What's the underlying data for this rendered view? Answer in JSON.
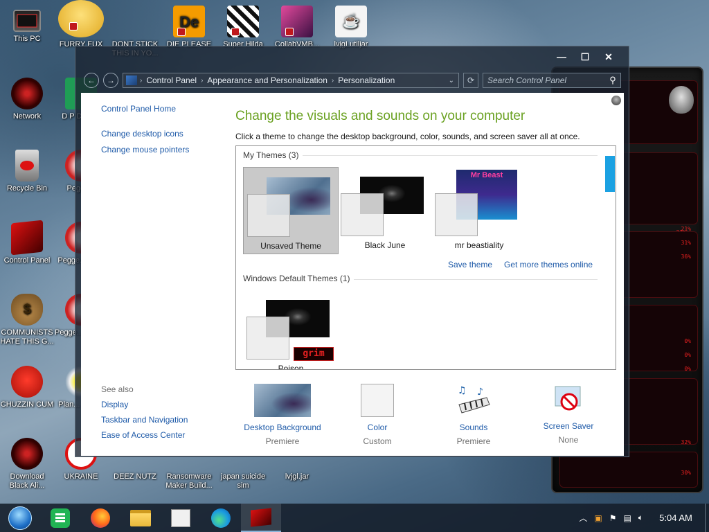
{
  "desktop": {
    "icons": [
      {
        "label": "This PC"
      },
      {
        "label": "FURRY FUX"
      },
      {
        "label": "DONT STICK THIS IN YO..."
      },
      {
        "label": "DIE PLEASE"
      },
      {
        "label": "Super Hilda"
      },
      {
        "label": "CollabVMB..."
      },
      {
        "label": "lvjgLutiljar"
      },
      {
        "label": "Network"
      },
      {
        "label": "D P DUM..."
      },
      {
        "label": "Recycle Bin"
      },
      {
        "label": "Pegge..."
      },
      {
        "label": "Control Panel"
      },
      {
        "label": "Pegge... De..."
      },
      {
        "label": "COMMUNISTS HATE THIS G..."
      },
      {
        "label": "Pegge... of War"
      },
      {
        "label": "CHUZZIN CUM"
      },
      {
        "label": "Plan... Zom..."
      },
      {
        "label": "Download Black Ali..."
      },
      {
        "label": "UKRAINE"
      },
      {
        "label": "DEEZ NUTZ"
      },
      {
        "label": "Ransomware Maker Build..."
      },
      {
        "label": "japan suicide sim"
      },
      {
        "label": "lvjgl.jar"
      }
    ],
    "glyph_de": "De"
  },
  "window": {
    "controls": {
      "minimize": "—",
      "maximize": "☐",
      "close": "✕"
    },
    "nav": {
      "back": "←",
      "forward": "→"
    },
    "breadcrumb": [
      "Control Panel",
      "Appearance and Personalization",
      "Personalization"
    ],
    "breadcrumb_sep": "›",
    "dropdown": "⌄",
    "refresh": "⟳",
    "search_placeholder": "Search Control Panel",
    "search_icon": "⚲"
  },
  "left_pane": {
    "links": [
      "Control Panel Home",
      "Change desktop icons",
      "Change mouse pointers"
    ]
  },
  "see_also": {
    "header": "See also",
    "links": [
      "Display",
      "Taskbar and Navigation",
      "Ease of Access Center"
    ]
  },
  "main": {
    "title": "Change the visuals and sounds on your computer",
    "subtitle": "Click a theme to change the desktop background, color, sounds, and screen saver all at once.",
    "my_themes_header": "My Themes (3)",
    "my_themes": [
      {
        "name": "Unsaved Theme",
        "selected": true
      },
      {
        "name": "Black June",
        "selected": false
      },
      {
        "name": "mr beastiality",
        "selected": false
      }
    ],
    "save_theme": "Save theme",
    "get_more": "Get more themes online",
    "default_header": "Windows Default Themes (1)",
    "default_themes": [
      {
        "name": "Poison"
      }
    ],
    "mrbeast_text": "Mr Beast",
    "grim_text": "grim"
  },
  "bottom_options": [
    {
      "label": "Desktop Background",
      "value": "Premiere",
      "icon": "desktop-background-icon"
    },
    {
      "label": "Color",
      "value": "Custom",
      "icon": "color-icon"
    },
    {
      "label": "Sounds",
      "value": "Premiere",
      "icon": "sounds-icon"
    },
    {
      "label": "Screen Saver",
      "value": "None",
      "icon": "screen-saver-icon"
    }
  ],
  "gadget": {
    "percents": [
      "21%",
      "31%",
      "36%",
      "0%",
      "0%",
      "0%",
      "32%",
      "30%"
    ]
  },
  "taskbar": {
    "items": [
      "start-orb-icon",
      "notepad-icon",
      "firefox-icon",
      "file-explorer-icon",
      "generic-app-icon",
      "edge-icon",
      "media-app-icon"
    ],
    "clock": "5:04 AM"
  },
  "colors": {
    "accent_link": "#1e5aa8",
    "title_green": "#6aa121",
    "scroll_thumb": "#1ba1e2",
    "gadget_red": "#e62020"
  }
}
